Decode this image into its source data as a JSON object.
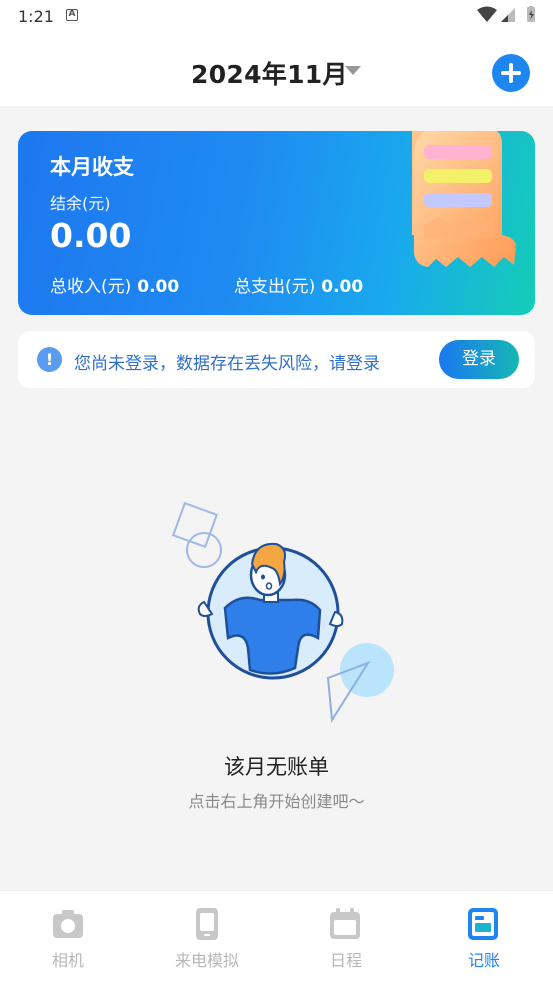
{
  "status_bar": {
    "time": "1:21",
    "notif_icon": "a-icon",
    "right_icons": [
      "wifi-icon",
      "signal-icon",
      "battery-icon"
    ]
  },
  "header": {
    "month": "2024年11月",
    "add_icon": "plus-icon"
  },
  "summary_card": {
    "title": "本月收支",
    "balance_label": "结余(元)",
    "balance_value": "0.00",
    "income_label": "总收入(元)",
    "income_value": "0.00",
    "expense_label": "总支出(元)",
    "expense_value": "0.00",
    "illustration": "receipt-icon"
  },
  "login_banner": {
    "message": "您尚未登录，数据存在丢失风险，请登录",
    "button": "登录",
    "icon": "info-icon"
  },
  "empty_state": {
    "title": "该月无账单",
    "subtitle": "点击右上角开始创建吧～",
    "illustration": "person-holding-frame"
  },
  "bottom_nav": {
    "items": [
      {
        "label": "相机",
        "icon": "camera-icon",
        "active": false
      },
      {
        "label": "来电模拟",
        "icon": "phone-icon",
        "active": false
      },
      {
        "label": "日程",
        "icon": "calendar-icon",
        "active": false
      },
      {
        "label": "记账",
        "icon": "ledger-icon",
        "active": true
      }
    ]
  },
  "colors": {
    "accent": "#1e86f1",
    "card_start": "#1d77f0",
    "card_end": "#14cdb7",
    "inactive": "#b8b8b8"
  }
}
